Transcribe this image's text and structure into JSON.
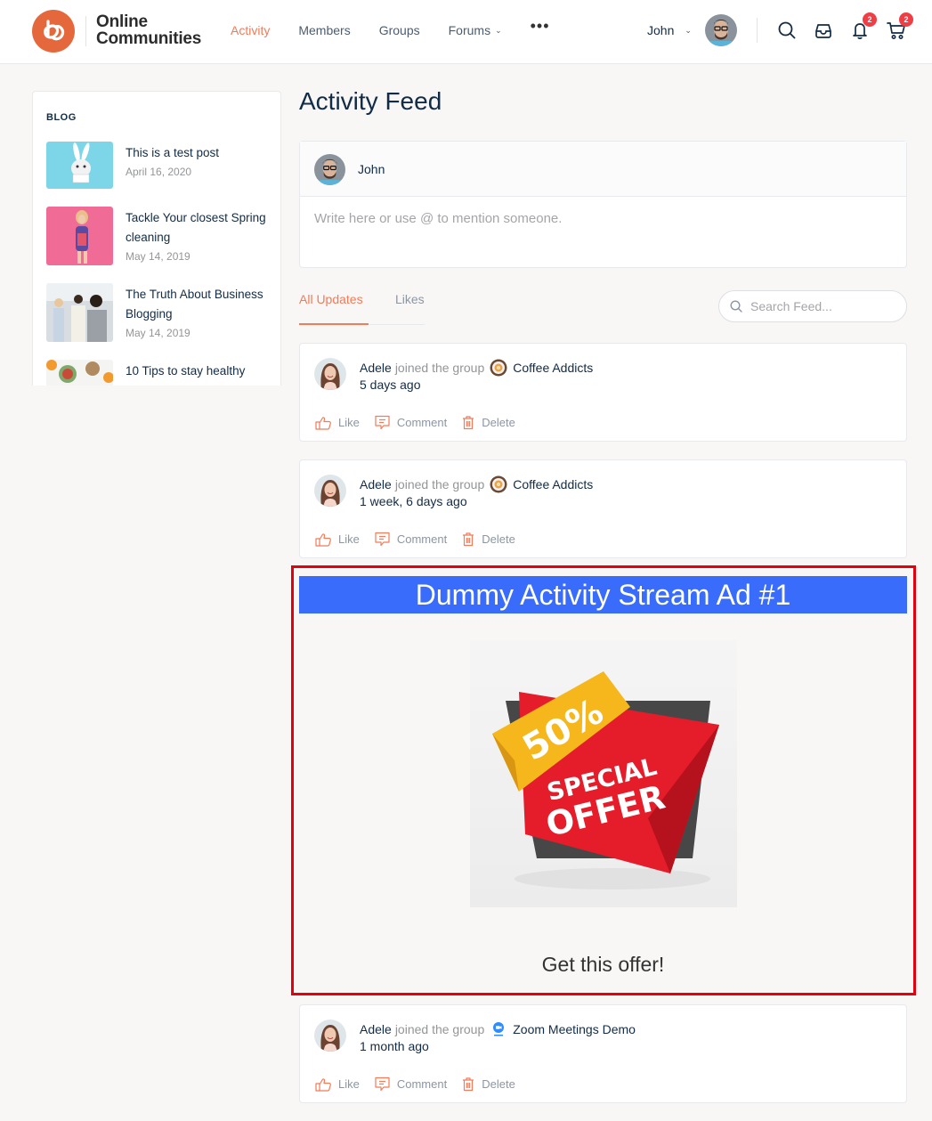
{
  "header": {
    "logo_line1": "Online",
    "logo_line2": "Communities",
    "nav": [
      {
        "label": "Activity",
        "active": true
      },
      {
        "label": "Members"
      },
      {
        "label": "Groups"
      },
      {
        "label": "Forums",
        "has_dropdown": true
      }
    ],
    "more_label": "•••",
    "user_name": "John",
    "notifications_count": "2",
    "cart_count": "2",
    "icons": [
      "search-icon",
      "inbox-icon",
      "bell-icon",
      "cart-icon"
    ]
  },
  "sidebar": {
    "heading": "BLOG",
    "posts": [
      {
        "title": "This is a test post",
        "date": "April 16, 2020"
      },
      {
        "title": "Tackle Your closest Spring cleaning",
        "date": "May 14, 2019"
      },
      {
        "title": "The Truth About Business Blogging",
        "date": "May 14, 2019"
      },
      {
        "title": "10 Tips to stay healthy",
        "date": ""
      }
    ]
  },
  "main": {
    "title": "Activity Feed",
    "post_box": {
      "user": "John",
      "placeholder": "Write here or use @ to mention someone."
    },
    "tabs": [
      {
        "label": "All Updates",
        "active": true
      },
      {
        "label": "Likes"
      }
    ],
    "search_placeholder": "Search Feed...",
    "activities": [
      {
        "user": "Adele",
        "action": "joined the group",
        "group": "Coffee Addicts",
        "group_icon": "coffee-icon",
        "time": "5 days ago"
      },
      {
        "user": "Adele",
        "action": "joined the group",
        "group": "Coffee Addicts",
        "group_icon": "coffee-icon",
        "time": "1 week, 6 days ago"
      },
      {
        "user": "Adele",
        "action": "joined the group",
        "group": "Zoom Meetings Demo",
        "group_icon": "zoom-icon",
        "time": "1 month ago"
      }
    ],
    "actions": {
      "like": "Like",
      "comment": "Comment",
      "delete": "Delete"
    },
    "ad": {
      "title": "Dummy Activity Stream Ad #1",
      "image_percent": "50%",
      "image_line1": "SPECIAL",
      "image_line2": "OFFER",
      "cta": "Get this offer!"
    }
  },
  "colors": {
    "accent": "#ef7c5a",
    "logo": "#e5683c",
    "badge": "#ef3e46",
    "ad_banner": "#3a6cfb",
    "ad_border": "#e3000f"
  }
}
